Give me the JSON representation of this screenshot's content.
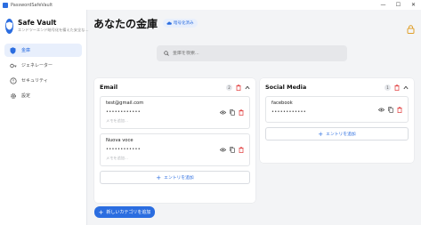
{
  "window": {
    "title": "PasswordSafeVault",
    "minimize": "—",
    "maximize": "☐",
    "close": "✕"
  },
  "sidebar": {
    "app_name": "Safe Vault",
    "app_subtitle": "エンドツーエンド暗号化を備えた安全な…",
    "items": [
      {
        "label": "金庫",
        "icon": "shield-icon",
        "active": true
      },
      {
        "label": "ジェネレーター",
        "icon": "key-icon",
        "active": false
      },
      {
        "label": "セキュリティ",
        "icon": "security-icon",
        "active": false
      },
      {
        "label": "設定",
        "icon": "gear-icon",
        "active": false
      }
    ]
  },
  "header": {
    "title": "あなたの金庫",
    "status": "暗号化済み"
  },
  "search": {
    "placeholder": "金庫を検索..."
  },
  "categories": [
    {
      "title": "Email",
      "count": "2",
      "entries": [
        {
          "name": "test@gmail.com",
          "password": "••••••••••••",
          "note": "メモを追加..."
        },
        {
          "name": "Nuova voce",
          "password": "••••••••••••",
          "note": "メモを追加..."
        }
      ],
      "add_label": "エントリを追加"
    },
    {
      "title": "Social Media",
      "count": "1",
      "entries": [
        {
          "name": "facebook",
          "password": "••••••••••••"
        }
      ],
      "add_label": "エントリを追加"
    }
  ],
  "new_category_label": "新しいカテゴリを追加",
  "colors": {
    "accent": "#2b6de0",
    "danger": "#e03a3a",
    "background": "#f3f4f6"
  }
}
